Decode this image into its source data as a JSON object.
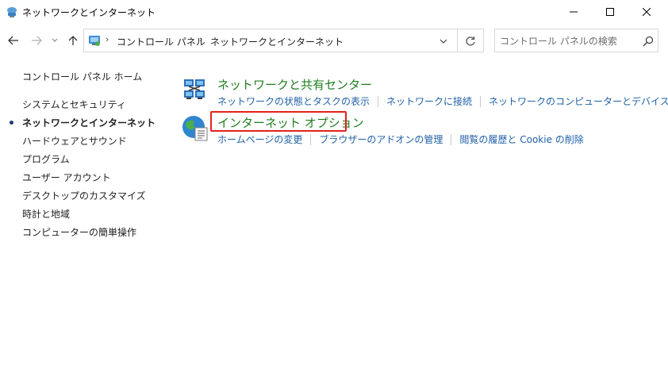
{
  "window": {
    "title": "ネットワークとインターネット",
    "icon": "network-globe-icon",
    "controls": {
      "minimize": "minimize-icon",
      "maximize": "maximize-icon",
      "close": "close-icon"
    }
  },
  "nav": {
    "back": "back-arrow-icon",
    "forward": "forward-arrow-icon",
    "recent": "chevron-down-icon",
    "up": "up-arrow-icon"
  },
  "address": {
    "breadcrumbs": [
      "コントロール パネル",
      "ネットワークとインターネット"
    ],
    "separator": "›"
  },
  "search": {
    "placeholder": "コントロール パネルの検索"
  },
  "sidebar": {
    "home": "コントロール パネル ホーム",
    "items": [
      {
        "label": "システムとセキュリティ",
        "active": false
      },
      {
        "label": "ネットワークとインターネット",
        "active": true
      },
      {
        "label": "ハードウェアとサウンド",
        "active": false
      },
      {
        "label": "プログラム",
        "active": false
      },
      {
        "label": "ユーザー アカウント",
        "active": false
      },
      {
        "label": "デスクトップのカスタマイズ",
        "active": false
      },
      {
        "label": "時計と地域",
        "active": false
      },
      {
        "label": "コンピューターの簡単操作",
        "active": false
      }
    ]
  },
  "categories": [
    {
      "title": "ネットワークと共有センター",
      "icon": "network-sharing-center-icon",
      "links": [
        "ネットワークの状態とタスクの表示",
        "ネットワークに接続",
        "ネットワークのコンピューターとデバイスの表示"
      ]
    },
    {
      "title": "インターネット オプション",
      "icon": "internet-options-icon",
      "links": [
        "ホームページの変更",
        "ブラウザーのアドオンの管理",
        "閲覧の履歴と Cookie の削除"
      ],
      "highlighted": true
    }
  ],
  "colors": {
    "category_title": "#1e7e1e",
    "link": "#1f5fa6",
    "highlight": "#e3221b"
  }
}
